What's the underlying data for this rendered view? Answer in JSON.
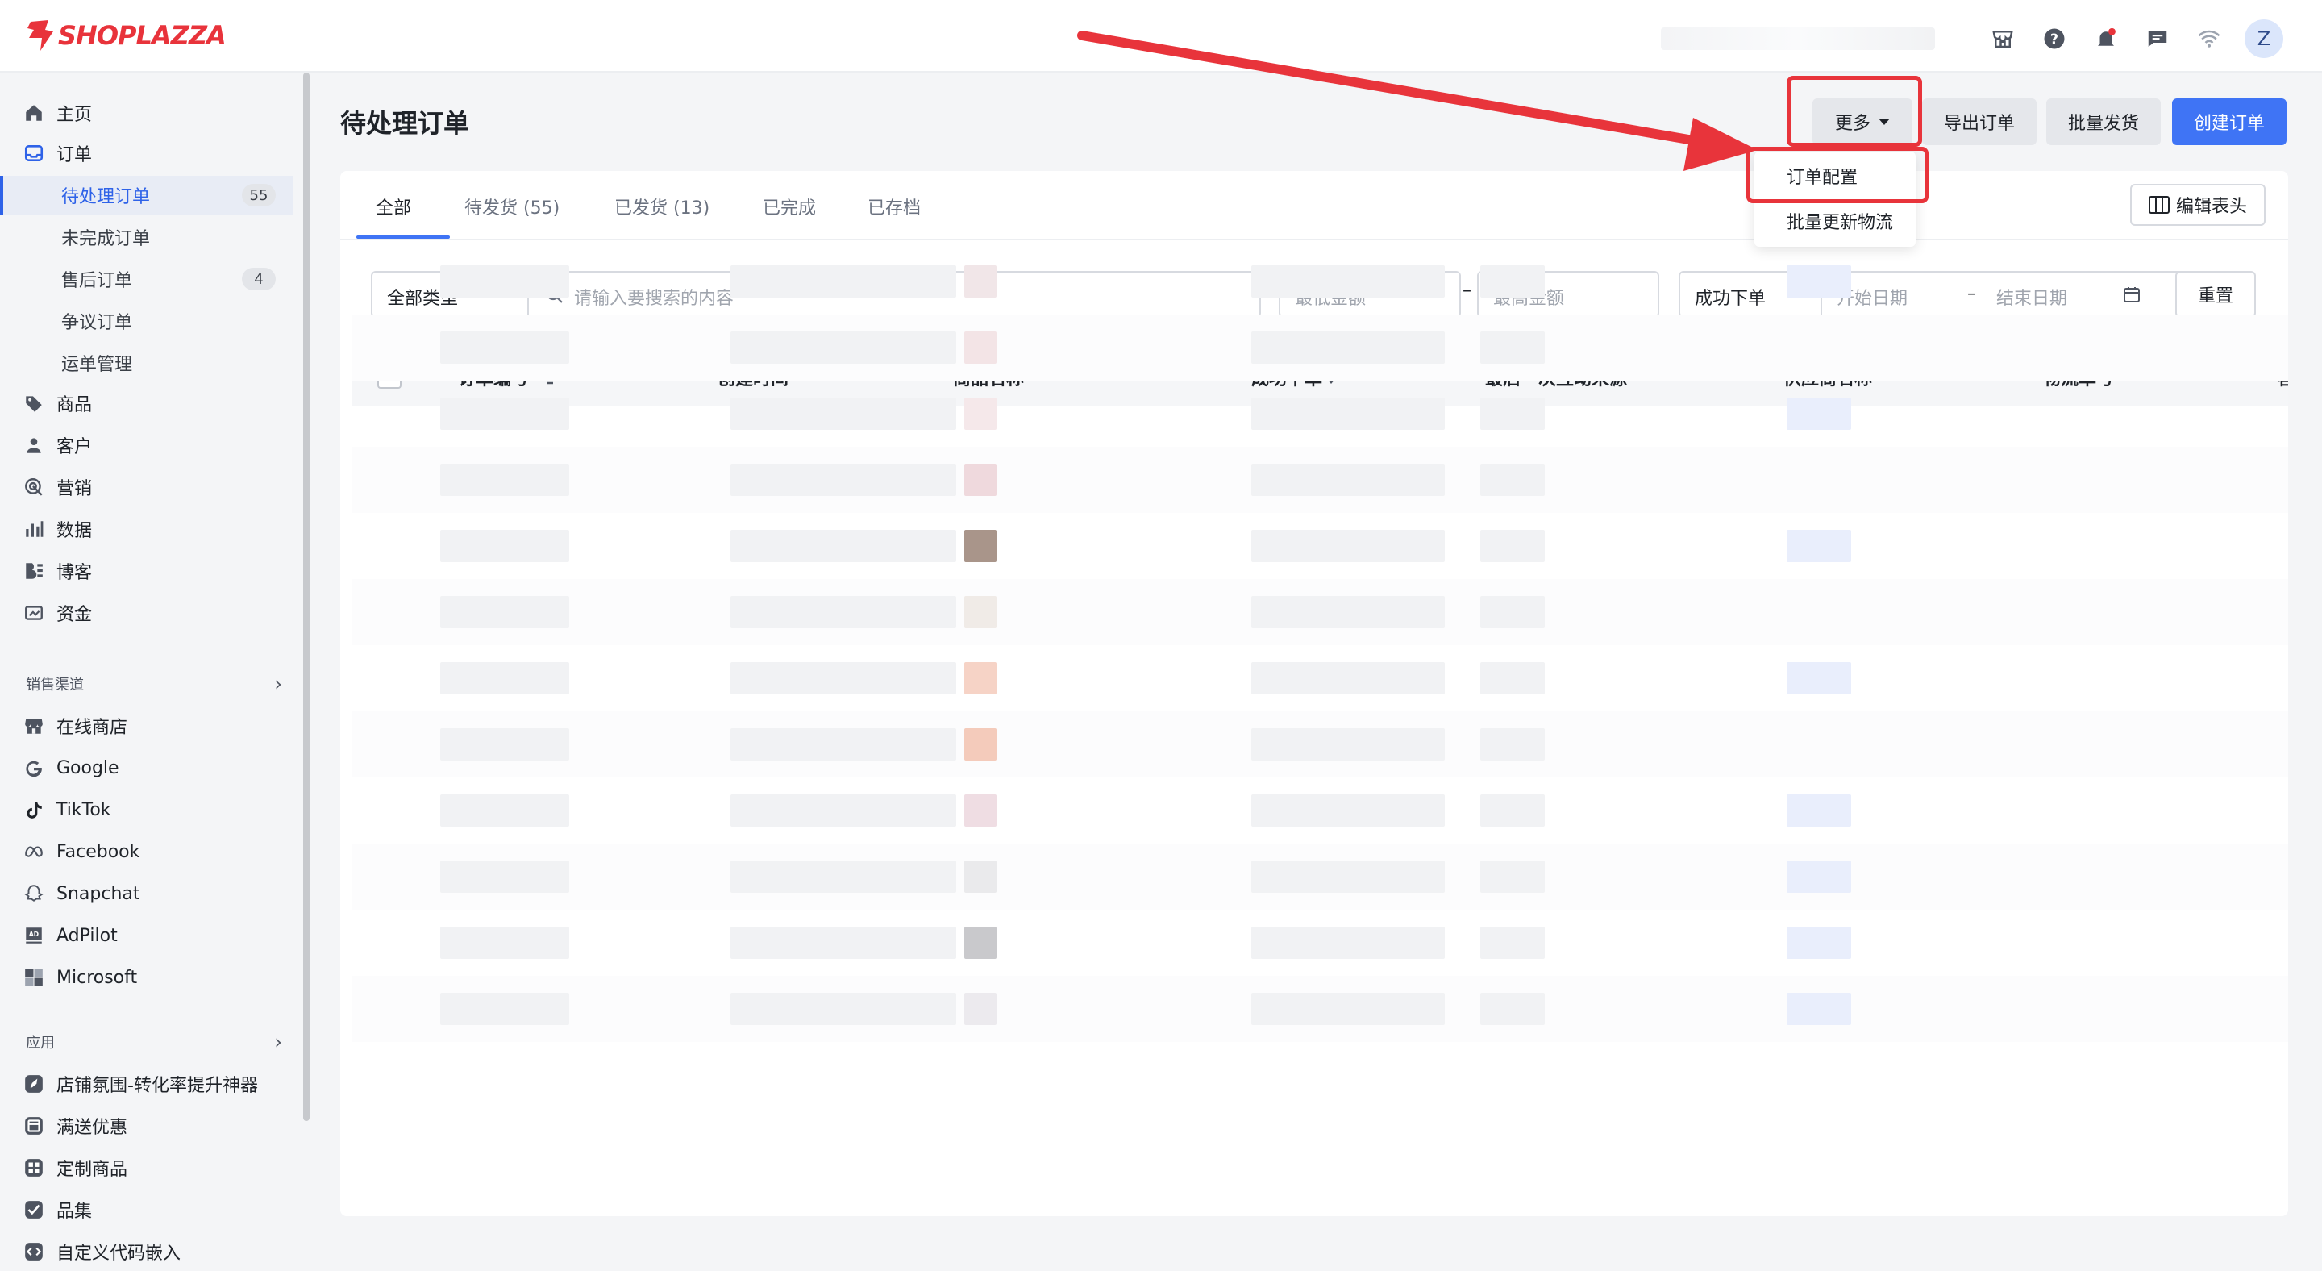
{
  "brand": {
    "name": "SHOPLAZZA",
    "color": "#e8333b"
  },
  "header": {
    "icons": [
      "store-icon",
      "help-icon",
      "bell-icon",
      "message-icon",
      "wifi-icon"
    ],
    "avatar_letter": "Z"
  },
  "sidebar": {
    "main_items": [
      {
        "label": "主页",
        "icon": "home-icon"
      },
      {
        "label": "订单",
        "icon": "inbox-icon"
      }
    ],
    "order_sub": [
      {
        "label": "待处理订单",
        "count": "55",
        "active": true
      },
      {
        "label": "未完成订单"
      },
      {
        "label": "售后订单",
        "count": "4"
      },
      {
        "label": "争议订单"
      },
      {
        "label": "运单管理"
      }
    ],
    "more_items": [
      {
        "label": "商品",
        "icon": "tag-icon"
      },
      {
        "label": "客户",
        "icon": "person-icon"
      },
      {
        "label": "营销",
        "icon": "target-icon"
      },
      {
        "label": "数据",
        "icon": "bar-chart-icon"
      },
      {
        "label": "博客",
        "icon": "blog-icon"
      },
      {
        "label": "资金",
        "icon": "wallet-icon"
      }
    ],
    "sales_channels_title": "销售渠道",
    "channels": [
      {
        "label": "在线商店",
        "icon": "store-icon"
      },
      {
        "label": "Google",
        "icon": "google-icon"
      },
      {
        "label": "TikTok",
        "icon": "tiktok-icon"
      },
      {
        "label": "Facebook",
        "icon": "meta-icon"
      },
      {
        "label": "Snapchat",
        "icon": "ghost-icon"
      },
      {
        "label": "AdPilot",
        "icon": "ad-icon"
      },
      {
        "label": "Microsoft",
        "icon": "windows-icon"
      }
    ],
    "apps_title": "应用",
    "apps": [
      {
        "label": "店铺氛围-转化率提升神器",
        "icon": "rocket-icon"
      },
      {
        "label": "满送优惠",
        "icon": "coupon-icon"
      },
      {
        "label": "定制商品",
        "icon": "grid-icon"
      },
      {
        "label": "品集",
        "icon": "check-icon"
      },
      {
        "label": "自定义代码嵌入",
        "icon": "code-icon"
      }
    ]
  },
  "main": {
    "title": "待处理订单",
    "buttons": {
      "more": "更多",
      "export": "导出订单",
      "bulk_ship": "批量发货",
      "create": "创建订单"
    },
    "more_menu": [
      "订单配置",
      "批量更新物流"
    ],
    "tabs": [
      "全部",
      "待发货 (55)",
      "已发货 (13)",
      "已完成",
      "已存档"
    ],
    "edit_header": "编辑表头",
    "filters": {
      "type_value": "全部类型",
      "search_placeholder": "请输入要搜索的内容",
      "min_placeholder": "最低金额",
      "max_placeholder": "最高金额",
      "date_type_value": "成功下单",
      "start_placeholder": "开始日期",
      "end_placeholder": "结束日期",
      "reset": "重置"
    },
    "columns": [
      "订单编号",
      "创建时间",
      "商品名称",
      "成功下单",
      "最后一次互动来源",
      "供应商名称",
      "物流单号",
      "客户"
    ]
  },
  "annotation": {
    "color": "#e8343b"
  }
}
